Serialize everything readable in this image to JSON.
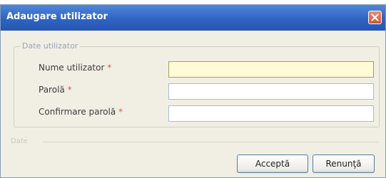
{
  "dialog": {
    "title": "Adaugare utilizator",
    "close_icon": "close-icon"
  },
  "group": {
    "legend": "Date utilizator",
    "fields": [
      {
        "label": "Nume utilizator",
        "required_mark": "*",
        "value": ""
      },
      {
        "label": "Parolă",
        "required_mark": "*",
        "value": ""
      },
      {
        "label": "Confirmare parolă",
        "required_mark": "*",
        "value": ""
      }
    ]
  },
  "separator": {
    "label": "Date"
  },
  "buttons": {
    "accept_label": "Acceptă",
    "cancel_label": "Renunţă"
  },
  "colors": {
    "titlebar": "#2f64c2",
    "required": "#e85454",
    "focused_input": "#fffbd6"
  }
}
